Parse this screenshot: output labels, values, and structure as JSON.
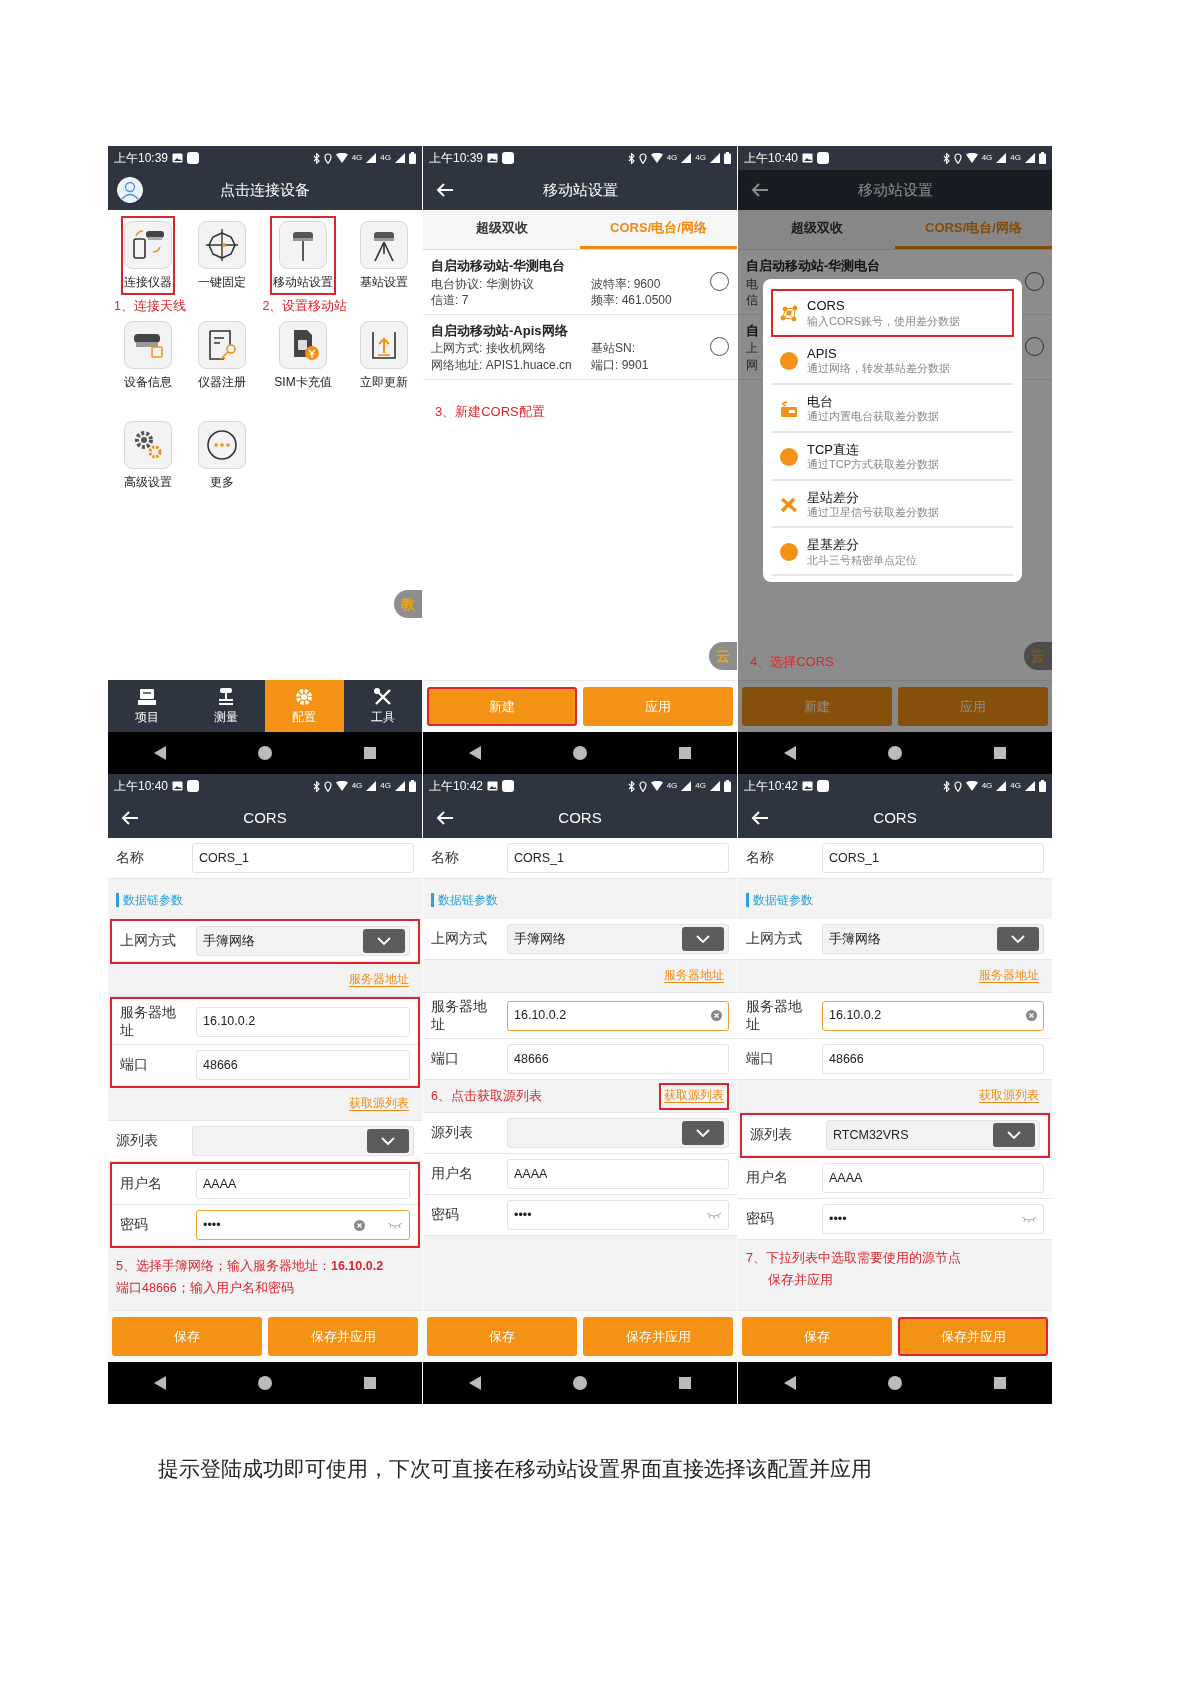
{
  "screens": [
    {
      "kind": "home",
      "status_bar": {
        "time": "上午10:39",
        "network_labels": [
          "4G",
          "4G"
        ]
      },
      "title": "点击连接设备",
      "tiles": [
        {
          "label": "连接仪器",
          "highlighted": true,
          "note": "1、连接天线"
        },
        {
          "label": "一键固定",
          "highlighted": false
        },
        {
          "label": "移动站设置",
          "highlighted": true,
          "note": "2、设置移动站"
        },
        {
          "label": "基站设置",
          "highlighted": false
        },
        {
          "label": "设备信息",
          "highlighted": false
        },
        {
          "label": "仪器注册",
          "highlighted": false
        },
        {
          "label": "SIM卡充值",
          "highlighted": false
        },
        {
          "label": "立即更新",
          "highlighted": false
        },
        {
          "label": "高级设置",
          "highlighted": false
        },
        {
          "label": "更多",
          "highlighted": false
        }
      ],
      "float_button": "教",
      "bottom_tabs": [
        {
          "label": "项目",
          "selected": false
        },
        {
          "label": "测量",
          "selected": false
        },
        {
          "label": "配置",
          "selected": true
        },
        {
          "label": "工具",
          "selected": false
        }
      ]
    },
    {
      "kind": "list",
      "status_bar": {
        "time": "上午10:39",
        "network_labels": [
          "4G",
          "4G"
        ]
      },
      "title": "移动站设置",
      "tabs": [
        {
          "label": "超级双收",
          "selected": false
        },
        {
          "label": "CORS/电台/网络",
          "selected": true
        }
      ],
      "items": [
        {
          "title": "自启动移动站-华测电台",
          "lines": [
            [
              "电台协议: 华测协议",
              "波特率: 9600"
            ],
            [
              "信道: 7",
              "频率: 461.0500"
            ]
          ],
          "selected": false
        },
        {
          "title": "自启动移动站-Apis网络",
          "lines": [
            [
              "上网方式: 接收机网络",
              "基站SN:"
            ],
            [
              "网络地址: APIS1.huace.cn",
              "端口: 9901"
            ]
          ],
          "selected": false
        }
      ],
      "note": "3、新建CORS配置",
      "float_button": "云",
      "buttons": [
        {
          "label": "新建",
          "highlighted": true
        },
        {
          "label": "应用",
          "highlighted": false
        }
      ]
    },
    {
      "kind": "list",
      "status_bar": {
        "time": "上午10:40",
        "network_labels": [
          "4G",
          "4G"
        ]
      },
      "title": "移动站设置",
      "tabs": [
        {
          "label": "超级双收",
          "selected": false
        },
        {
          "label": "CORS/电台/网络",
          "selected": true
        }
      ],
      "items": [
        {
          "title": "自启动移动站-华测电台",
          "lines": [
            [
              "电"
            ],
            [
              "信"
            ]
          ],
          "selected": false
        },
        {
          "title": "自",
          "lines": [
            [
              "上"
            ],
            [
              "网"
            ]
          ],
          "selected": false
        }
      ],
      "dialog": {
        "options": [
          {
            "title": "CORS",
            "subtitle": "输入CORS账号，使用差分数据",
            "highlighted": true
          },
          {
            "title": "APIS",
            "subtitle": "通过网络，转发基站差分数据",
            "highlighted": false
          },
          {
            "title": "电台",
            "subtitle": "通过内置电台获取差分数据",
            "highlighted": false
          },
          {
            "title": "TCP直连",
            "subtitle": "通过TCP方式获取差分数据",
            "highlighted": false
          },
          {
            "title": "星站差分",
            "subtitle": "通过卫星信号获取差分数据",
            "highlighted": false
          },
          {
            "title": "星基差分",
            "subtitle": "北斗三号精密单点定位",
            "highlighted": false
          }
        ]
      },
      "note": "4、选择CORS",
      "float_button": "云",
      "buttons": [
        {
          "label": "新建",
          "highlighted": false
        },
        {
          "label": "应用",
          "highlighted": false
        }
      ]
    },
    {
      "kind": "form",
      "status_bar": {
        "time": "上午10:40",
        "network_labels": [
          "4G",
          "4G"
        ]
      },
      "title": "CORS",
      "rows": [
        {
          "kind": "input",
          "label": "名称",
          "value": "CORS_1",
          "focused": false
        },
        {
          "kind": "section",
          "label": "数据链参数"
        },
        {
          "kind": "group",
          "highlighted": true,
          "rows": [
            {
              "kind": "select",
              "label": "上网方式",
              "value": "手簿网络"
            }
          ]
        },
        {
          "kind": "link",
          "text": "服务器地址",
          "highlighted": false
        },
        {
          "kind": "group",
          "highlighted": true,
          "rows": [
            {
              "kind": "input",
              "label": "服务器地址",
              "value": "16.10.0.2",
              "focused": false
            },
            {
              "kind": "input",
              "label": "端口",
              "value": "48666",
              "focused": false
            }
          ]
        },
        {
          "kind": "link",
          "text": "获取源列表",
          "highlighted": false
        },
        {
          "kind": "select",
          "label": "源列表"
        },
        {
          "kind": "group",
          "highlighted": true,
          "rows": [
            {
              "kind": "input",
              "label": "用户名",
              "value": "AAAA",
              "focused": false
            },
            {
              "kind": "password",
              "label": "密码",
              "value": "••••",
              "focused": true
            }
          ]
        }
      ],
      "note_lines": [
        "5、选择手簿网络；输入服务器地址：**16.10.0.2**",
        "端口48666；输入用户名和密码"
      ],
      "buttons": [
        {
          "label": "保存",
          "highlighted": false
        },
        {
          "label": "保存并应用",
          "highlighted": false
        }
      ]
    },
    {
      "kind": "form",
      "status_bar": {
        "time": "上午10:42",
        "network_labels": [
          "4G",
          "4G"
        ]
      },
      "title": "CORS",
      "rows": [
        {
          "kind": "input",
          "label": "名称",
          "value": "CORS_1",
          "focused": false
        },
        {
          "kind": "section",
          "label": "数据链参数"
        },
        {
          "kind": "select",
          "label": "上网方式",
          "value": "手簿网络"
        },
        {
          "kind": "link",
          "text": "服务器地址",
          "highlighted": false
        },
        {
          "kind": "input",
          "label": "服务器地址",
          "value": "16.10.0.2",
          "focused": true
        },
        {
          "kind": "input",
          "label": "端口",
          "value": "48666",
          "focused": false
        },
        {
          "kind": "link",
          "text": "获取源列表",
          "note": "6、点击获取源列表",
          "highlighted": true
        },
        {
          "kind": "select",
          "label": "源列表"
        },
        {
          "kind": "input",
          "label": "用户名",
          "value": "AAAA",
          "focused": false
        },
        {
          "kind": "password",
          "label": "密码",
          "value": "••••",
          "focused": false
        }
      ],
      "buttons": [
        {
          "label": "保存",
          "highlighted": false
        },
        {
          "label": "保存并应用",
          "highlighted": false
        }
      ]
    },
    {
      "kind": "form",
      "status_bar": {
        "time": "上午10:42",
        "network_labels": [
          "4G",
          "4G"
        ]
      },
      "title": "CORS",
      "rows": [
        {
          "kind": "input",
          "label": "名称",
          "value": "CORS_1",
          "focused": false
        },
        {
          "kind": "section",
          "label": "数据链参数"
        },
        {
          "kind": "select",
          "label": "上网方式",
          "value": "手簿网络"
        },
        {
          "kind": "link",
          "text": "服务器地址",
          "highlighted": false
        },
        {
          "kind": "input",
          "label": "服务器地址",
          "value": "16.10.0.2",
          "focused": true
        },
        {
          "kind": "input",
          "label": "端口",
          "value": "48666",
          "focused": false
        },
        {
          "kind": "link",
          "text": "获取源列表",
          "highlighted": false
        },
        {
          "kind": "group",
          "highlighted": true,
          "rows": [
            {
              "kind": "select",
              "label": "源列表",
              "value": "RTCM32VRS"
            }
          ]
        },
        {
          "kind": "input",
          "label": "用户名",
          "value": "AAAA",
          "focused": false
        },
        {
          "kind": "password",
          "label": "密码",
          "value": "••••",
          "focused": false
        }
      ],
      "note_lines": [
        "7、下拉列表中选取需要使用的源节点",
        "保存并应用"
      ],
      "buttons": [
        {
          "label": "保存",
          "highlighted": false
        },
        {
          "label": "保存并应用",
          "highlighted": true
        }
      ]
    }
  ],
  "caption": "提示登陆成功即可使用，下次可直接在移动站设置界面直接选择该配置并应用"
}
